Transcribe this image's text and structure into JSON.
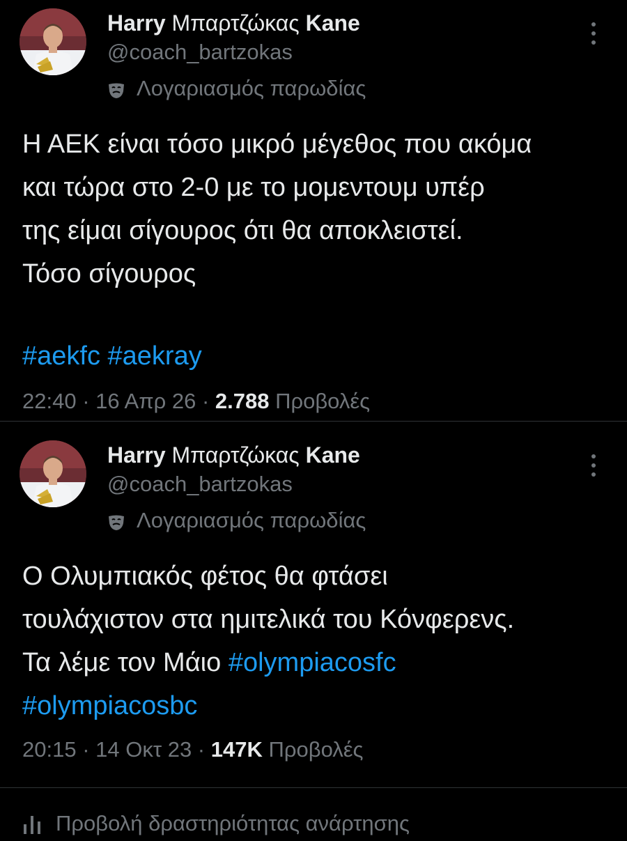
{
  "colors": {
    "background": "#000000",
    "text": "#e7e9ea",
    "secondary": "#71767b",
    "hashtag": "#1d9bf0",
    "divider": "#2f3336"
  },
  "tweets": [
    {
      "author": {
        "name_part1": "Harry",
        "name_part2": " Μπαρτζώκας ",
        "name_part3": "Kane",
        "handle": "@coach_bartzokas",
        "parody_label": "Λογαριασμός παρωδίας"
      },
      "text_lines": [
        "Η ΑΕΚ είναι τόσο μικρό μέγεθος που ακόμα",
        "και τώρα στο 2-0 με το μομεντουμ υπέρ",
        "της είμαι σίγουρος ότι θα αποκλειστεί.",
        "Τόσο σίγουρος"
      ],
      "hashtags": "#aekfc #aekray",
      "time": "22:40",
      "date": "16 Απρ 26",
      "views_count": "2.788",
      "views_label": "Προβολές"
    },
    {
      "author": {
        "name_part1": "Harry",
        "name_part2": " Μπαρτζώκας ",
        "name_part3": "Kane",
        "handle": "@coach_bartzokas",
        "parody_label": "Λογαριασμός παρωδίας"
      },
      "text_line1": "Ο Ολυμπιακός φέτος θα φτάσει",
      "text_line2": "τουλάχιστον στα ημιτελικά του Κόνφερενς.",
      "text_line3_plain": "Τα λέμε τον Μάιο ",
      "text_line3_hashtag": "#olympiacosfc",
      "text_line4_hashtag": "#olympiacosbc",
      "time": "20:15",
      "date": "14 Οκτ 23",
      "views_count": "147K",
      "views_label": "Προβολές"
    }
  ],
  "separator": " · ",
  "activity_label": "Προβολή δραστηριότητας ανάρτησης",
  "icons": {
    "avatar": "profile-photo",
    "parody": "theater-mask-icon",
    "more": "more-options-icon",
    "activity": "analytics-bars-icon"
  }
}
